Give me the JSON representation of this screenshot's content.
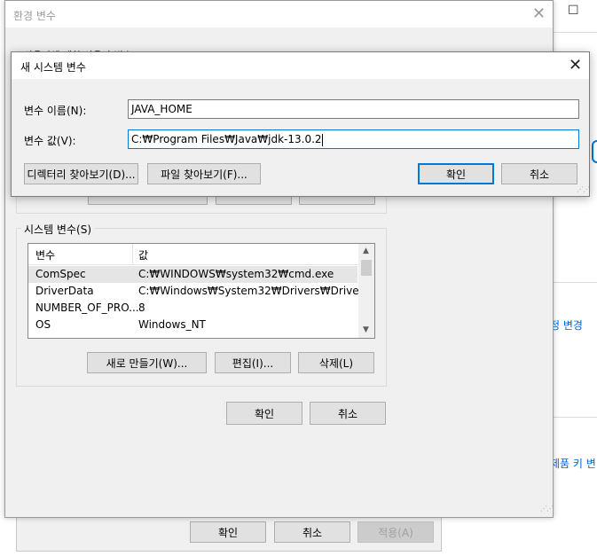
{
  "system_properties": {
    "right_items": {
      "restore_glyph": "☐",
      "link_change_settings": "정 변경",
      "link_product_key": "제품 키 변"
    },
    "buttons": {
      "ok": "확인",
      "cancel": "취소",
      "apply": "적용(A)"
    }
  },
  "env_window": {
    "title": "환경 변수",
    "user_vars_group": "사용자에 대한 사용자 변수(U)",
    "system_vars_group": "시스템 변수(S)",
    "list_headers": {
      "name": "변수",
      "value": "값"
    },
    "rows": [
      {
        "name": "ComSpec",
        "value": "C:₩WINDOWS₩system32₩cmd.exe"
      },
      {
        "name": "DriverData",
        "value": "C:₩Windows₩System32₩Drivers₩DriverData"
      },
      {
        "name": "NUMBER_OF_PRO...",
        "value": "8"
      },
      {
        "name": "OS",
        "value": "Windows_NT"
      }
    ],
    "buttons": {
      "new": "새로 만들기(W)...",
      "edit": "편집(I)...",
      "delete": "삭제(L)",
      "ok": "확인",
      "cancel": "취소"
    }
  },
  "new_var_dialog": {
    "title": "새 시스템 변수",
    "name_label": "변수 이름(N):",
    "name_value": "JAVA_HOME",
    "value_label": "변수 값(V):",
    "value_value": "C:₩Program Files₩Java₩jdk-13.0.2",
    "buttons": {
      "browse_dir": "디렉터리 찾아보기(D)...",
      "browse_file": "파일 찾아보기(F)...",
      "ok": "확인",
      "cancel": "취소"
    }
  },
  "icons": {
    "close": "close-icon",
    "restore": "restore-icon",
    "scroll_up": "scroll-up-icon",
    "scroll_down": "scroll-down-icon",
    "resize_grip": "resize-grip-icon"
  },
  "colors": {
    "dialog_bg": "#f0f0f0",
    "focus_border": "#0078d7",
    "selected_row": "#e5e5e5"
  }
}
